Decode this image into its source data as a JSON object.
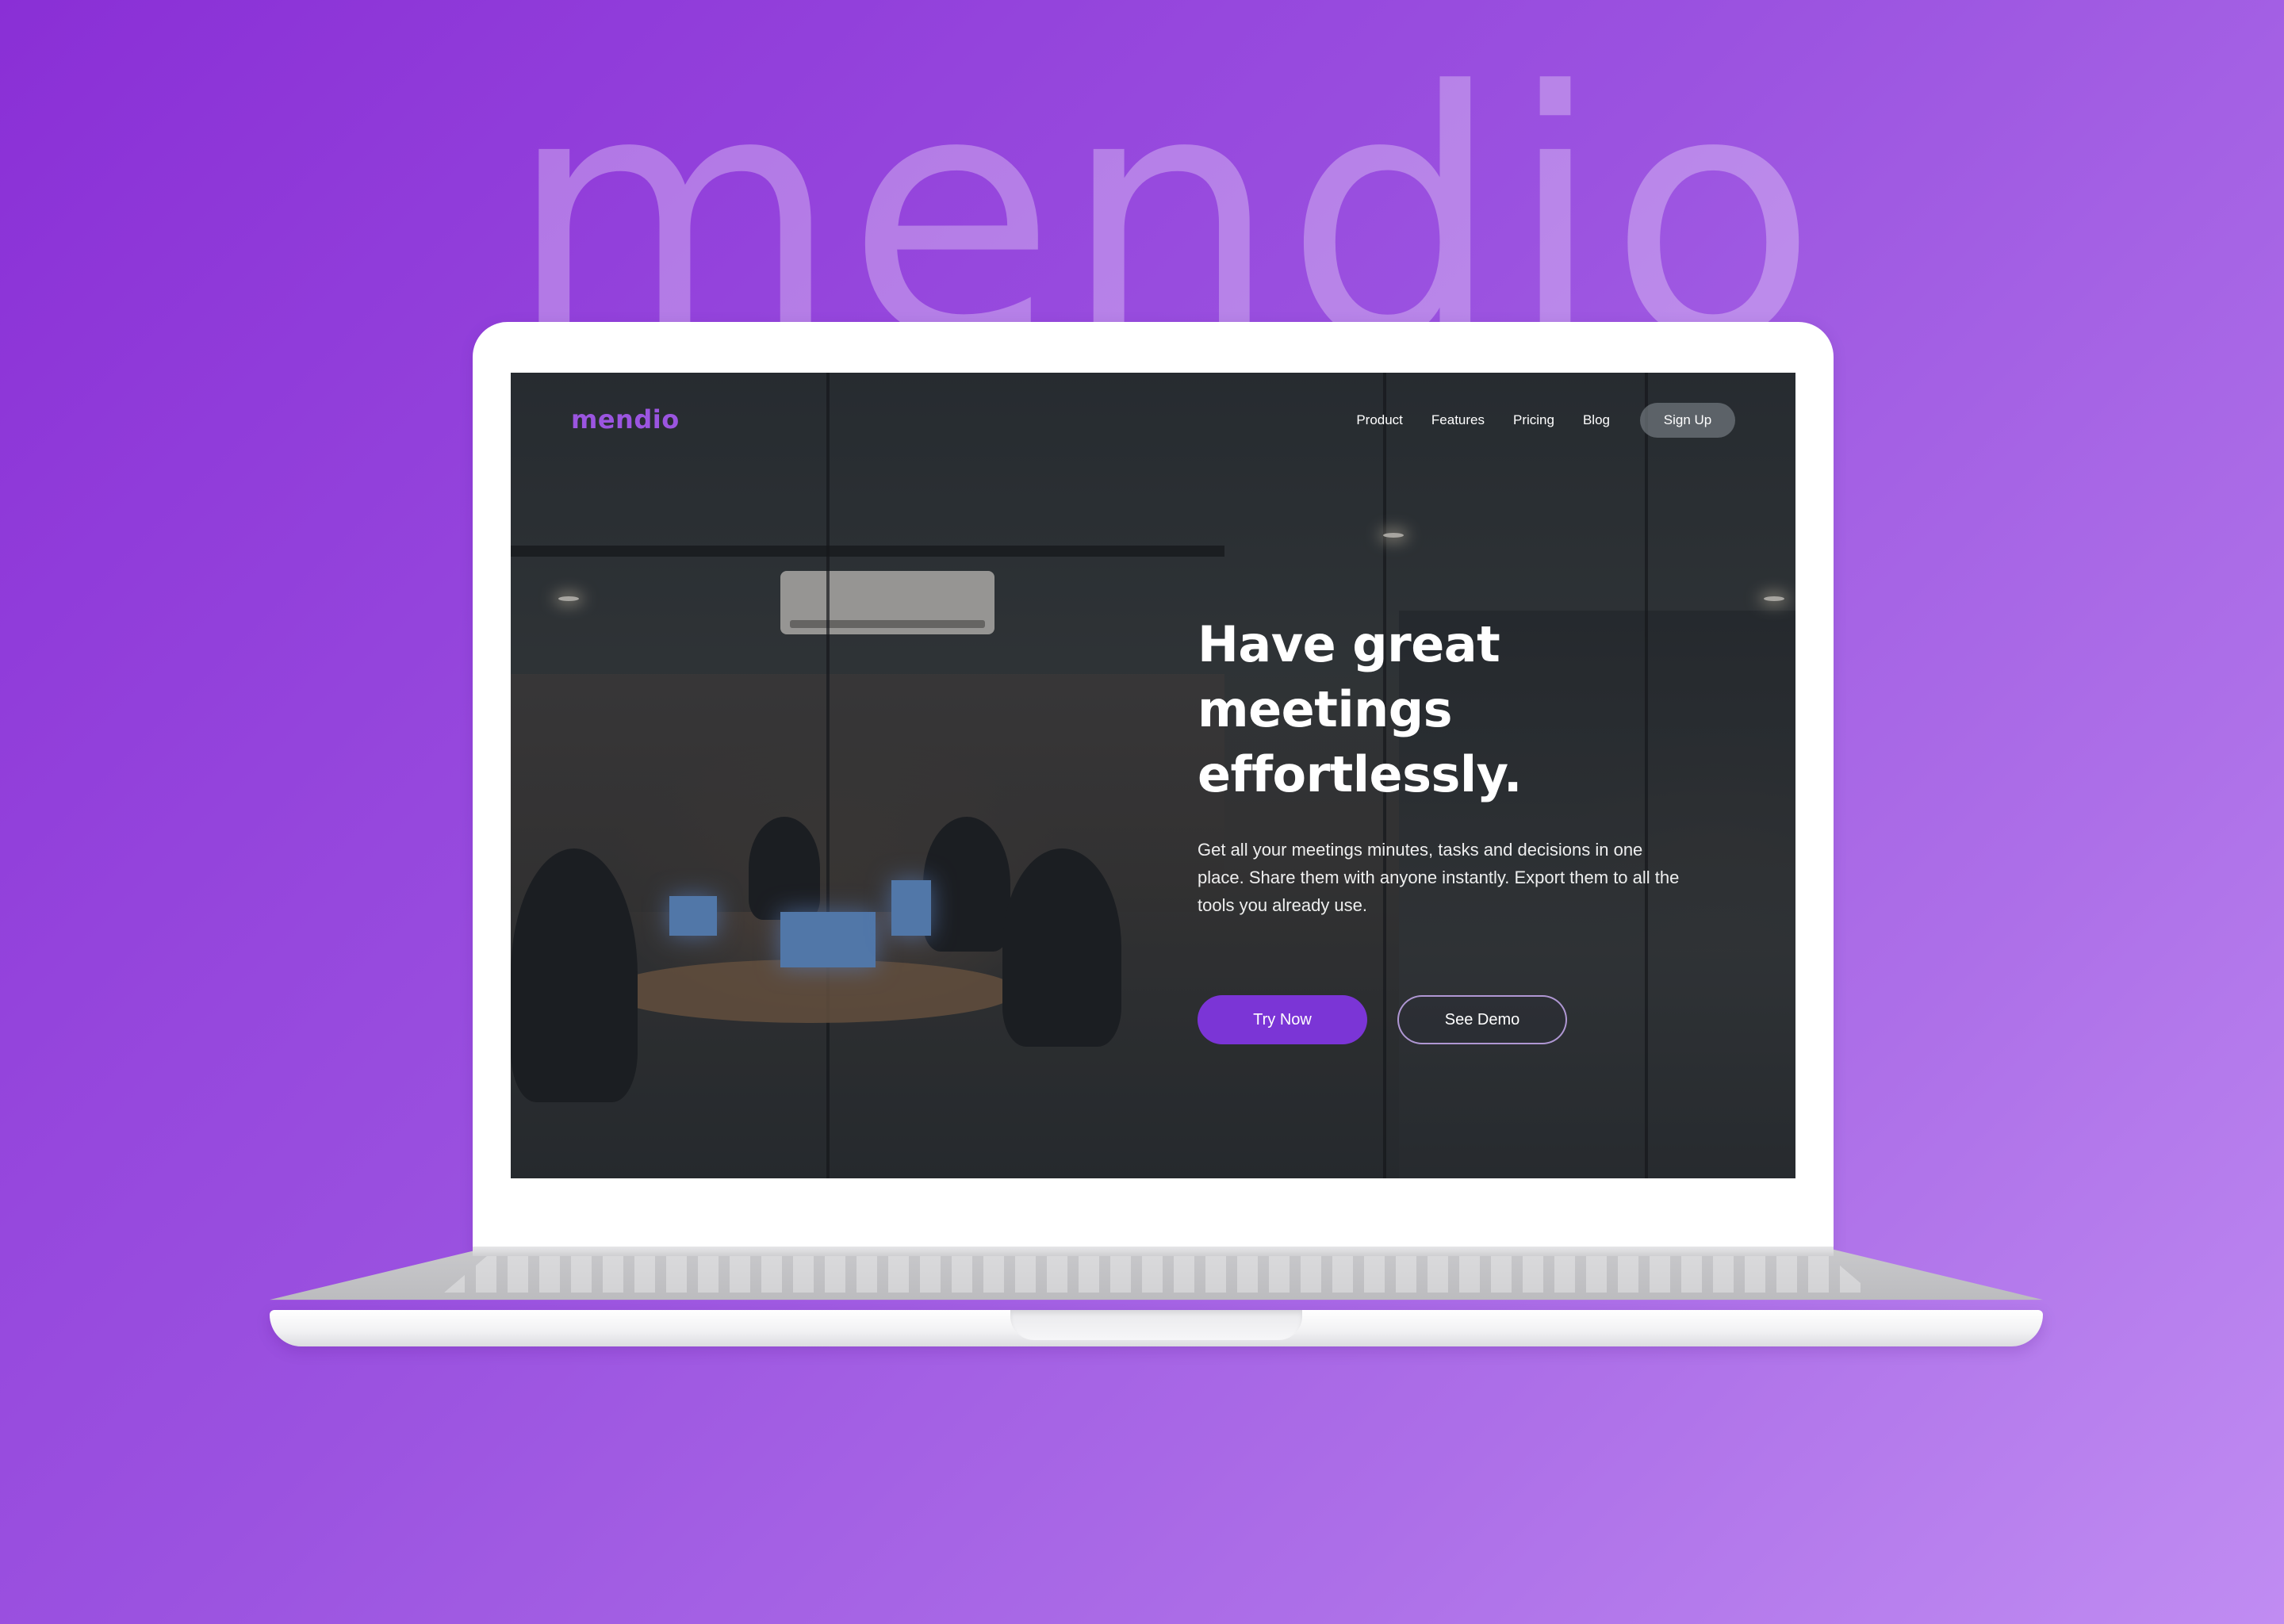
{
  "background_wordmark": "mendio",
  "site": {
    "logo": "mendio",
    "nav": {
      "links": [
        "Product",
        "Features",
        "Pricing",
        "Blog"
      ],
      "signup": "Sign Up"
    },
    "hero": {
      "headline_line1": "Have great meetings",
      "headline_line2": "effortlessly.",
      "subtext": "Get all your meetings minutes, tasks and decisions in one place. Share them with anyone instantly. Export them to all the tools you already use.",
      "primary_button": "Try Now",
      "secondary_button": "See Demo"
    }
  },
  "colors": {
    "brand_purple": "#9b55e0",
    "button_purple": "#7b35d6",
    "background_gradient_start": "#8a2fd6",
    "background_gradient_end": "#c08cf2"
  }
}
